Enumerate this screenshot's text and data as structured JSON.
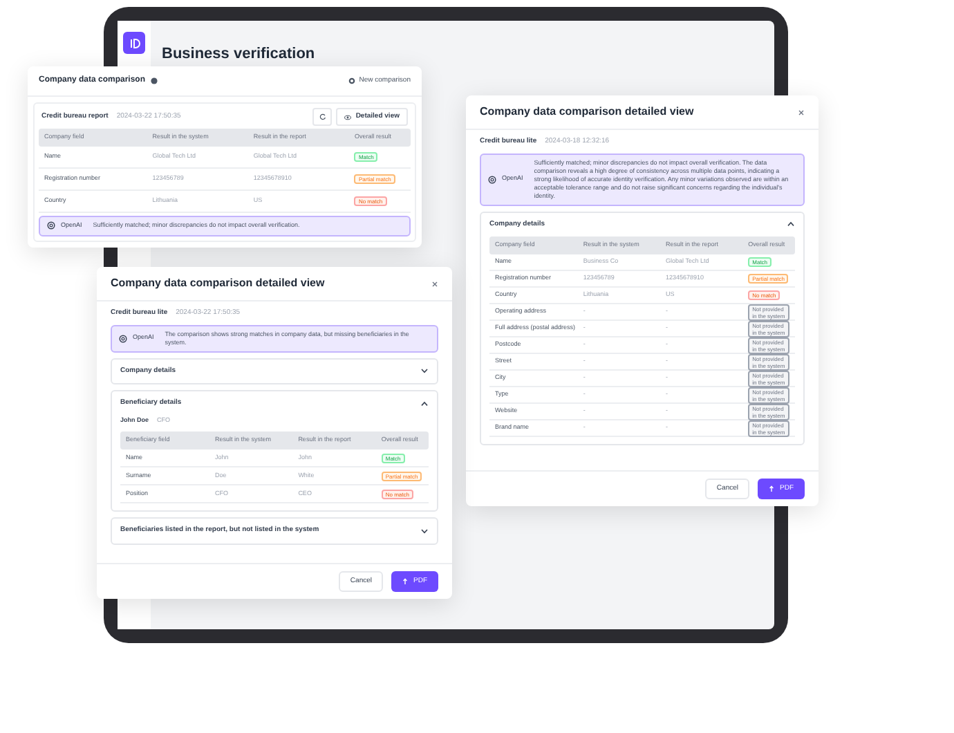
{
  "app": {
    "title": "Business verification"
  },
  "summary_card": {
    "title": "Company data comparison",
    "action": "New comparison",
    "report_label": "Credit bureau report",
    "report_time": "2024-03-22 17:50:35",
    "detail_button": "Detailed view",
    "columns": [
      "Company field",
      "Result in the system",
      "Result in the report",
      "Overall result"
    ],
    "rows": [
      {
        "field": "Name",
        "system": "Global Tech Ltd",
        "report": "Global Tech Ltd",
        "result": "Match",
        "kind": "match"
      },
      {
        "field": "Registration number",
        "system": "123456789",
        "report": "12345678910",
        "result": "Partial match",
        "kind": "partial"
      },
      {
        "field": "Country",
        "system": "Lithuania",
        "report": "US",
        "result": "No match",
        "kind": "none"
      }
    ],
    "ai": {
      "brand": "OpenAI",
      "text": "Sufficiently matched; minor discrepancies do not impact overall verification."
    }
  },
  "front_dialog": {
    "title": "Company data comparison detailed view",
    "source": "Credit bureau lite",
    "time": "2024-03-22 17:50:35",
    "ai": {
      "brand": "OpenAI",
      "text": "The comparison shows strong matches in company data, but missing beneficiaries in the system."
    },
    "sections": [
      {
        "title": "Company details",
        "expanded": false
      },
      {
        "title": "Beneficiary details",
        "expanded": true,
        "person": "John Doe",
        "role": "CFO",
        "columns": [
          "Beneficiary field",
          "Result in the system",
          "Result in the report",
          "Overall result"
        ],
        "rows": [
          {
            "field": "Name",
            "system": "John",
            "report": "John",
            "result": "Match",
            "kind": "match"
          },
          {
            "field": "Surname",
            "system": "Doe",
            "report": "White",
            "result": "Partial match",
            "kind": "partial"
          },
          {
            "field": "Position",
            "system": "CFO",
            "report": "CEO",
            "result": "No match",
            "kind": "none"
          }
        ]
      },
      {
        "title": "Beneficiaries listed in the report, but not listed in the system",
        "expanded": false
      }
    ],
    "buttons": {
      "cancel": "Cancel",
      "primary": "PDF"
    }
  },
  "back_dialog": {
    "title": "Company data comparison detailed view",
    "source": "Credit bureau lite",
    "time": "2024-03-18 12:32:16",
    "ai": {
      "brand": "OpenAI",
      "text": "Sufficiently matched; minor discrepancies do not impact overall verification. The data comparison reveals a high degree of consistency across multiple data points, indicating a strong likelihood of accurate identity verification. Any minor variations observed are within an acceptable tolerance range and do not raise significant concerns regarding the individual's identity."
    },
    "sections": [
      {
        "title": "Company details",
        "expanded": true,
        "columns": [
          "Company field",
          "Result in the system",
          "Result in the report",
          "Overall result"
        ],
        "rows": [
          {
            "field": "Name",
            "system": "Business Co",
            "report": "Global Tech Ltd",
            "result": "Match",
            "kind": "match"
          },
          {
            "field": "Registration number",
            "system": "123456789",
            "report": "12345678910",
            "result": "Partial match",
            "kind": "partial"
          },
          {
            "field": "Country",
            "system": "Lithuania",
            "report": "US",
            "result": "No match",
            "kind": "none"
          },
          {
            "field": "Operating address",
            "system": "-",
            "report": "-",
            "result": "Not provided in the system",
            "kind": "missing"
          },
          {
            "field": "Full address (postal address)",
            "system": "-",
            "report": "-",
            "result": "Not provided in the system",
            "kind": "missing"
          },
          {
            "field": "Postcode",
            "system": "-",
            "report": "-",
            "result": "Not provided in the system",
            "kind": "missing"
          },
          {
            "field": "Street",
            "system": "-",
            "report": "-",
            "result": "Not provided in the system",
            "kind": "missing"
          },
          {
            "field": "City",
            "system": "-",
            "report": "-",
            "result": "Not provided in the system",
            "kind": "missing"
          },
          {
            "field": "Type",
            "system": "-",
            "report": "-",
            "result": "Not provided in the system",
            "kind": "missing"
          },
          {
            "field": "Website",
            "system": "-",
            "report": "-",
            "result": "Not provided in the system",
            "kind": "missing"
          },
          {
            "field": "Brand name",
            "system": "-",
            "report": "-",
            "result": "Not provided in the system",
            "kind": "missing"
          }
        ]
      }
    ],
    "buttons": {
      "cancel": "Cancel",
      "primary": "PDF"
    }
  }
}
